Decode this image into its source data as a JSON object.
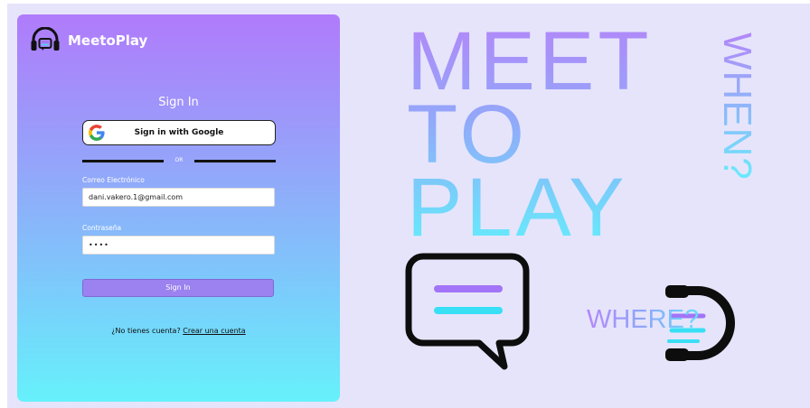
{
  "brand": {
    "name": "MeetoPlay",
    "logo_icon": "headset-chat-icon"
  },
  "signin": {
    "title": "Sign In",
    "google_label": "Sign in with Google",
    "divider_text": "OR",
    "email_label": "Correo Electrónico",
    "email_value": "dani.vakero.1@gmail.com",
    "password_label": "Contraseña",
    "password_value": "••••",
    "submit_label": "Sign In",
    "register_prompt": "¿No tienes cuenta?",
    "register_link": "Crear una cuenta"
  },
  "hero": {
    "words": [
      "MEET",
      "TO",
      "PLAY"
    ],
    "when": "WHEN?",
    "where": "WHERE?"
  },
  "colors": {
    "purple": "#b07bfb",
    "cyan": "#66f1fb",
    "accent_button": "#9b82f0",
    "background": "#e6e4fb"
  }
}
